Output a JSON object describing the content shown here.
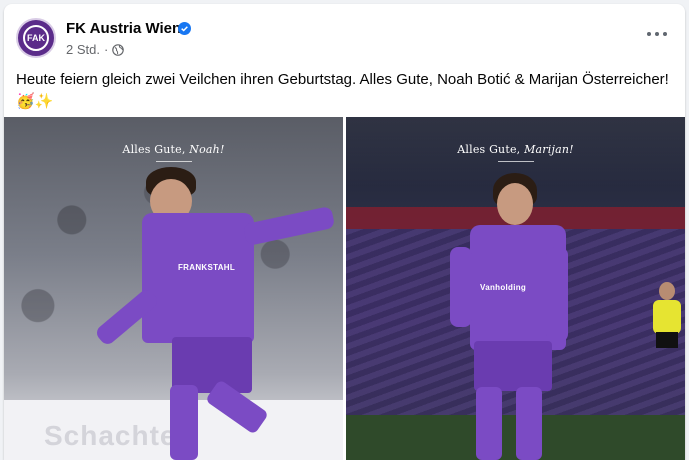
{
  "post": {
    "page_name": "FK Austria Wien",
    "time": "2 Std.",
    "separator": "·",
    "text": "Heute feiern gleich zwei Veilchen ihren Geburtstag. Alles Gute, Noah Botić & Marijan Österreicher!",
    "emojis": "🥳✨"
  },
  "photos": [
    {
      "greeting": "Alles Gute,",
      "name": "Noah!",
      "sponsor": "FRANKSTAHL",
      "board": "Schachtel"
    },
    {
      "greeting": "Alles Gute,",
      "name": "Marijan!",
      "sponsor": "Vanholding"
    }
  ],
  "colors": {
    "brand_purple": "#5b2c8a",
    "verified_blue": "#1877f2",
    "text": "#050505",
    "meta": "#65676b"
  },
  "icons": [
    "verified-badge-icon",
    "globe-icon",
    "more-options-icon"
  ]
}
